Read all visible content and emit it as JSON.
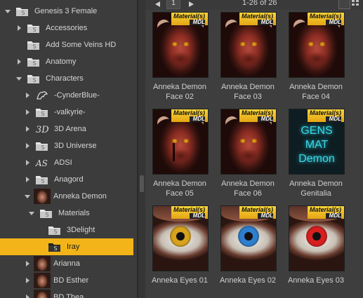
{
  "tree": {
    "rows": [
      {
        "label": "Genesis 3 Female",
        "expand": "down",
        "icon": "folder-icon"
      },
      {
        "label": "Accessories",
        "expand": "right",
        "icon": "folder-icon"
      },
      {
        "label": "Add Some Veins HD",
        "expand": "none",
        "icon": "folder-icon"
      },
      {
        "label": "Anatomy",
        "expand": "right",
        "icon": "folder-icon"
      },
      {
        "label": "Characters",
        "expand": "down",
        "icon": "folder-icon"
      },
      {
        "label": "-CynderBlue-",
        "expand": "right",
        "icon": "dragon-logo-icon"
      },
      {
        "label": "-valkyrie-",
        "expand": "right",
        "icon": "folder-icon"
      },
      {
        "label": "3D Arena",
        "expand": "right",
        "icon": "3d-arena-logo-icon"
      },
      {
        "label": "3D Universe",
        "expand": "right",
        "icon": "folder-icon"
      },
      {
        "label": "ADSI",
        "expand": "right",
        "icon": "adsi-logo-icon"
      },
      {
        "label": "Anagord",
        "expand": "right",
        "icon": "folder-icon"
      },
      {
        "label": "Anneka Demon",
        "expand": "down",
        "icon": "anneka-thumbnail-icon"
      },
      {
        "label": "Materials",
        "expand": "down",
        "icon": "folder-icon"
      },
      {
        "label": "3Delight",
        "expand": "none",
        "icon": "folder-icon"
      },
      {
        "label": "Iray",
        "expand": "none",
        "icon": "folder-icon",
        "selected": true
      },
      {
        "label": "Arianna",
        "expand": "right",
        "icon": "arianna-thumbnail-icon"
      },
      {
        "label": "BD Esther",
        "expand": "right",
        "icon": "esther-thumbnail-icon"
      },
      {
        "label": "BD Thea",
        "expand": "right",
        "icon": "thea-thumbnail-icon"
      }
    ]
  },
  "pager": {
    "page": "1",
    "info": "1-26 of 26"
  },
  "badge": {
    "material": "Material(s)",
    "mdl": "MDL"
  },
  "items": [
    {
      "line1": "Anneka Demon",
      "line2": "Face 02",
      "kind": "face"
    },
    {
      "line1": "Anneka Demon",
      "line2": "Face 03",
      "kind": "face"
    },
    {
      "line1": "Anneka Demon",
      "line2": "Face 04",
      "kind": "face"
    },
    {
      "line1": "Anneka Demon",
      "line2": "Face 05",
      "kind": "face-tear"
    },
    {
      "line1": "Anneka Demon",
      "line2": "Face 06",
      "kind": "face"
    },
    {
      "line1": "Anneka Demon",
      "line2": "Genitalia",
      "kind": "genitalia"
    },
    {
      "line1": "Anneka Eyes 01",
      "line2": "",
      "kind": "eye",
      "iris_color": "#d8a21c"
    },
    {
      "line1": "Anneka Eyes 02",
      "line2": "",
      "kind": "eye",
      "iris_color": "#2f7fcf"
    },
    {
      "line1": "Anneka Eyes 03",
      "line2": "",
      "kind": "eye",
      "iris_color": "#d81f1f"
    }
  ],
  "genitalia_thumb_text": [
    "GENS",
    "MAT",
    "Demon"
  ],
  "colors": {
    "selection": "#f2b418",
    "panel": "#3c3c3c",
    "badge": "#f2c22a"
  }
}
